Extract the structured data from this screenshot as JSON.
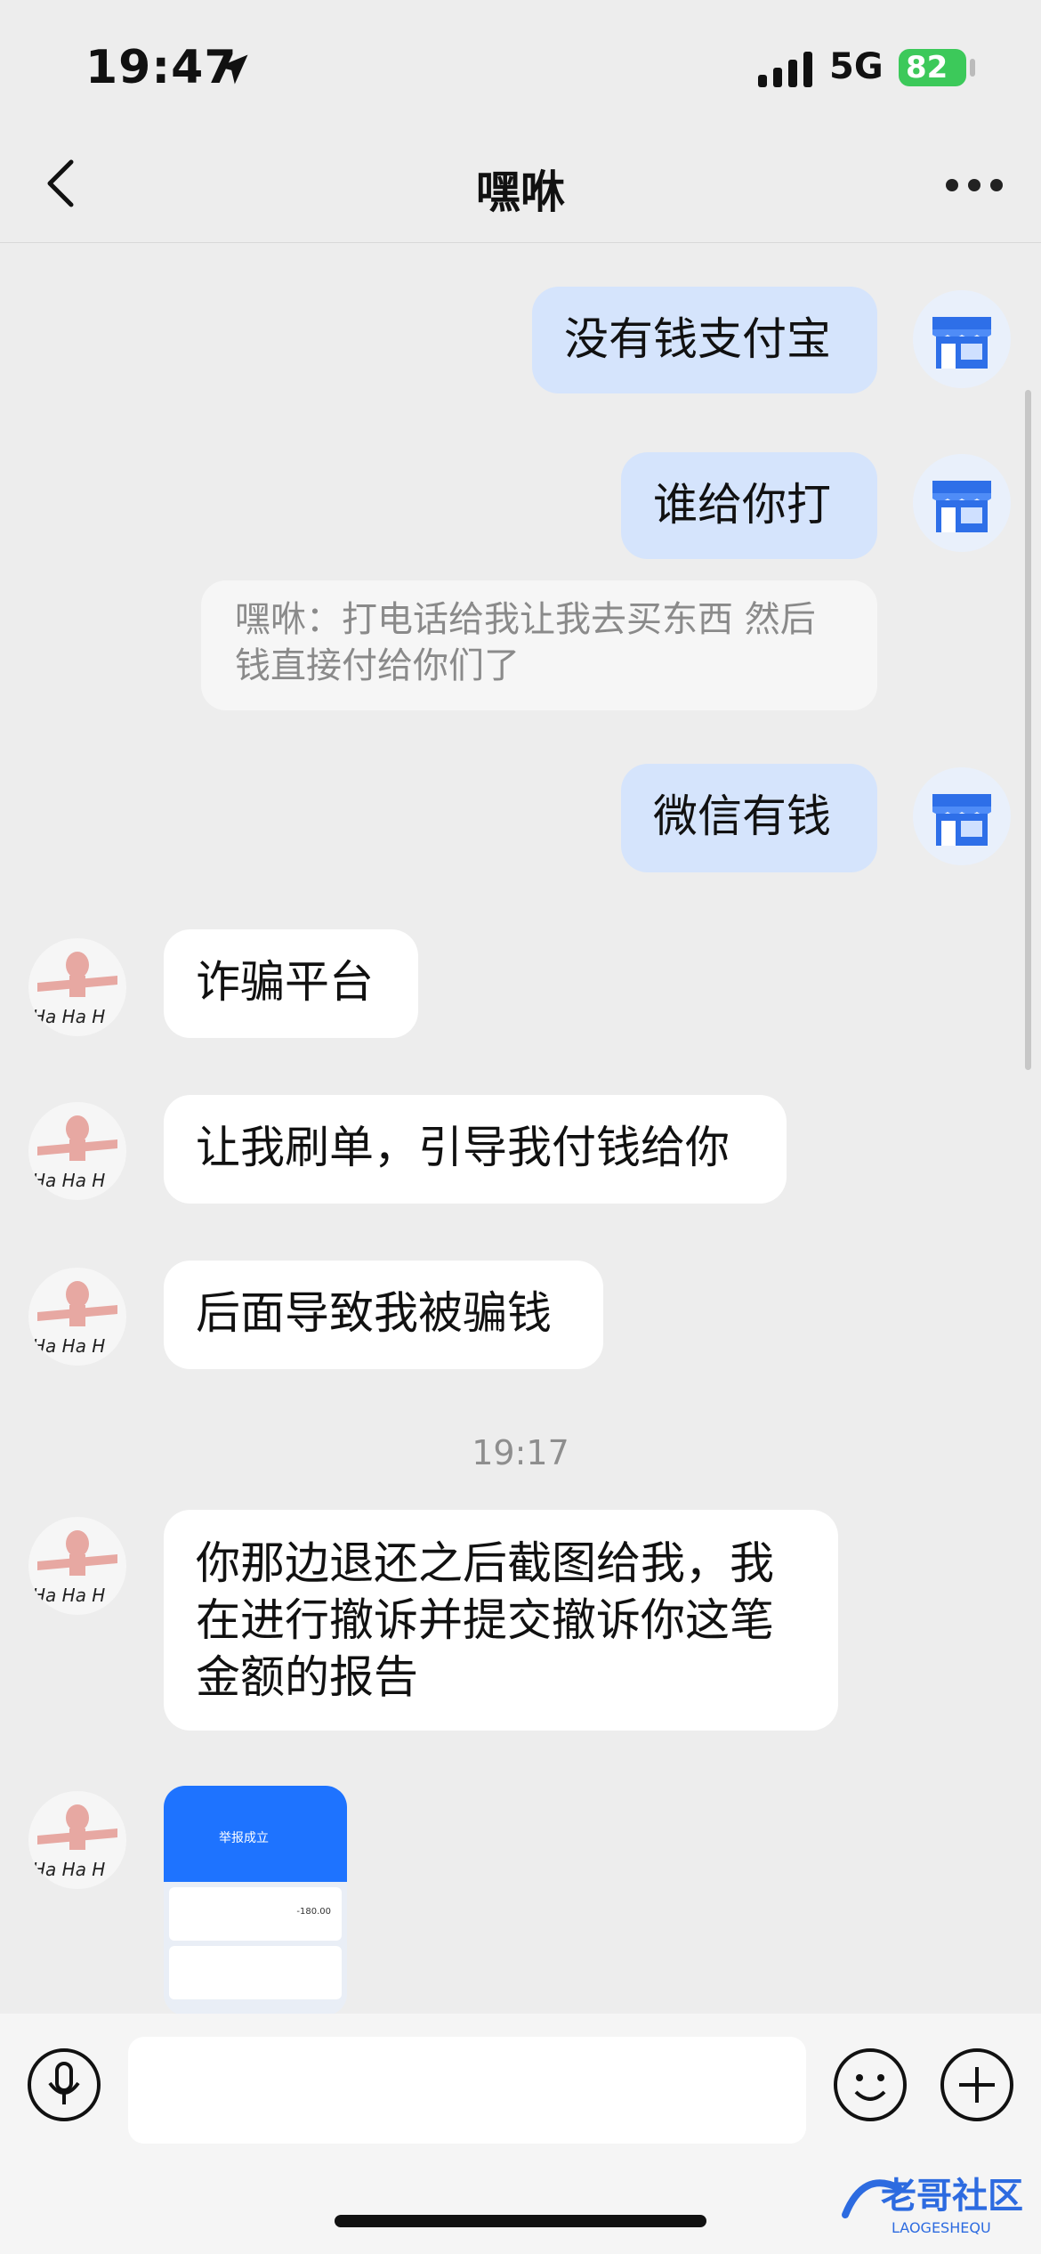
{
  "status_bar": {
    "time": "19:47",
    "network": "5G",
    "battery": "82"
  },
  "nav": {
    "title": "嘿咻"
  },
  "messages": [
    {
      "side": "me",
      "text": "没有钱支付宝"
    },
    {
      "side": "me",
      "text": "谁给你打"
    },
    {
      "side": "quote",
      "text": "嘿咻：打电话给我让我去买东西 然后钱直接付给你们了"
    },
    {
      "side": "me",
      "text": "微信有钱"
    },
    {
      "side": "other",
      "text": "诈骗平台"
    },
    {
      "side": "other",
      "text": "让我刷单，引导我付钱给你"
    },
    {
      "side": "other",
      "text": "后面导致我被骗钱"
    },
    {
      "side": "timestamp",
      "text": "19:17"
    },
    {
      "side": "other",
      "text": "你那边退还之后截图给我，我在进行撤诉并提交撤诉你这笔金额的报告"
    }
  ],
  "image_thumb": {
    "badge": "举报成立",
    "amount": "-180.00"
  },
  "icons": {
    "location": "location-arrow-icon",
    "signal": "signal-bars-icon",
    "back": "chevron-left-icon",
    "more": "more-dots-icon",
    "voice": "microphone-icon",
    "emoji": "smiley-icon",
    "plus": "plus-circle-icon"
  },
  "colors": {
    "my_bubble": "#d5e4fc",
    "other_bubble": "#ffffff",
    "battery": "#3cc95a",
    "background": "#ededed"
  },
  "watermark": {
    "text": "老哥社区",
    "subtext": "LAOGESHEQU"
  }
}
